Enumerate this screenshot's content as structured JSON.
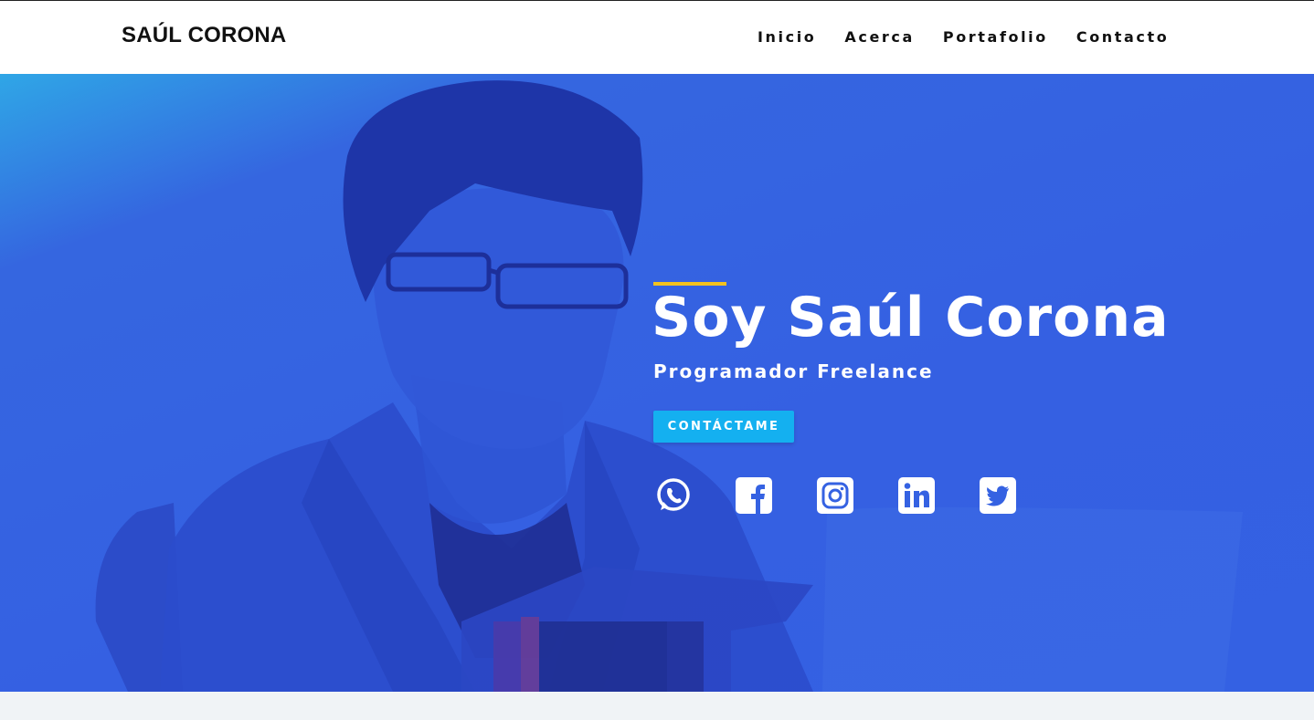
{
  "header": {
    "brand": "SAÚL CORONA",
    "nav": [
      "Inicio",
      "Acerca",
      "Portafolio",
      "Contacto"
    ]
  },
  "hero": {
    "title": "Soy Saúl Corona",
    "subtitle": "Programador Freelance",
    "cta_label": "CONTÁCTAME",
    "socials": [
      "whatsapp-icon",
      "facebook-icon",
      "instagram-icon",
      "linkedin-icon",
      "twitter-icon"
    ]
  },
  "colors": {
    "hero_blue": "#3562e2",
    "accent_yellow": "#f3c21f",
    "cta_cyan": "#14b0f0"
  }
}
